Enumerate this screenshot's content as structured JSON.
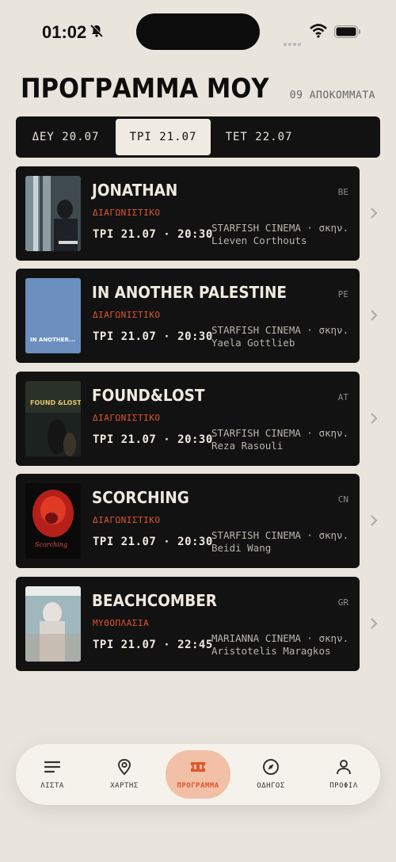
{
  "status": {
    "time": "01:02"
  },
  "header": {
    "title": "ΠΡΟΓΡΑΜΜΑ ΜΟΥ",
    "clip_count": "09 ΑΠΟΚΟΜΜΑΤΑ"
  },
  "day_tabs": [
    {
      "label": "ΔΕΥ 20.07"
    },
    {
      "label": "ΤΡΙ 21.07"
    },
    {
      "label": "ΤΕΤ 22.07"
    }
  ],
  "films": [
    {
      "title": "JONATHAN",
      "country": "BE",
      "section": "ΔΙΑΓΩΝΙΣΤΙΚΟ",
      "showtime": "ΤΡΙ 21.07 · 20:30",
      "venue": "STARFISH CINEMA · σκην.",
      "director": "Lieven Corthouts",
      "poster_text": ""
    },
    {
      "title": "IN ANOTHER PALESTINE",
      "country": "PE",
      "section": "ΔΙΑΓΩΝΙΣΤΙΚΟ",
      "showtime": "ΤΡΙ 21.07 · 20:30",
      "venue": "STARFISH CINEMA · σκην.",
      "director": "Yaela Gottlieb",
      "poster_text": "IN ANOTHER..."
    },
    {
      "title": "FOUND&LOST",
      "country": "AT",
      "section": "ΔΙΑΓΩΝΙΣΤΙΚΟ",
      "showtime": "ΤΡΙ 21.07 · 20:30",
      "venue": "STARFISH CINEMA · σκην.",
      "director": "Reza Rasouli",
      "poster_text": "FOUND &LOST"
    },
    {
      "title": "SCORCHING",
      "country": "CN",
      "section": "ΔΙΑΓΩΝΙΣΤΙΚΟ",
      "showtime": "ΤΡΙ 21.07 · 20:30",
      "venue": "STARFISH CINEMA · σκην.",
      "director": "Beidi Wang",
      "poster_text": "Scorching"
    },
    {
      "title": "BEACHCOMBER",
      "country": "GR",
      "section": "ΜΥΘΟΠΛΑΣΙΑ",
      "showtime": "ΤΡΙ 21.07 · 22:45",
      "venue": "MARIANNA CINEMA · σκην.",
      "director": "Aristotelis Maragkos",
      "poster_text": ""
    }
  ],
  "nav": [
    {
      "label": "ΛΙΣΤΑ",
      "icon": "list-icon"
    },
    {
      "label": "ΧΑΡΤΗΣ",
      "icon": "map-pin-icon"
    },
    {
      "label": "ΠΡΟΓΡΑΜΜΑ",
      "icon": "ticket-icon"
    },
    {
      "label": "ΟΔΗΓΟΣ",
      "icon": "compass-icon"
    },
    {
      "label": "ΠΡΟΦΙΛ",
      "icon": "user-icon"
    }
  ],
  "colors": {
    "background": "#e9e5dc",
    "card": "#121212",
    "accent": "#e0552a",
    "active_nav": "#f2bfa7"
  }
}
